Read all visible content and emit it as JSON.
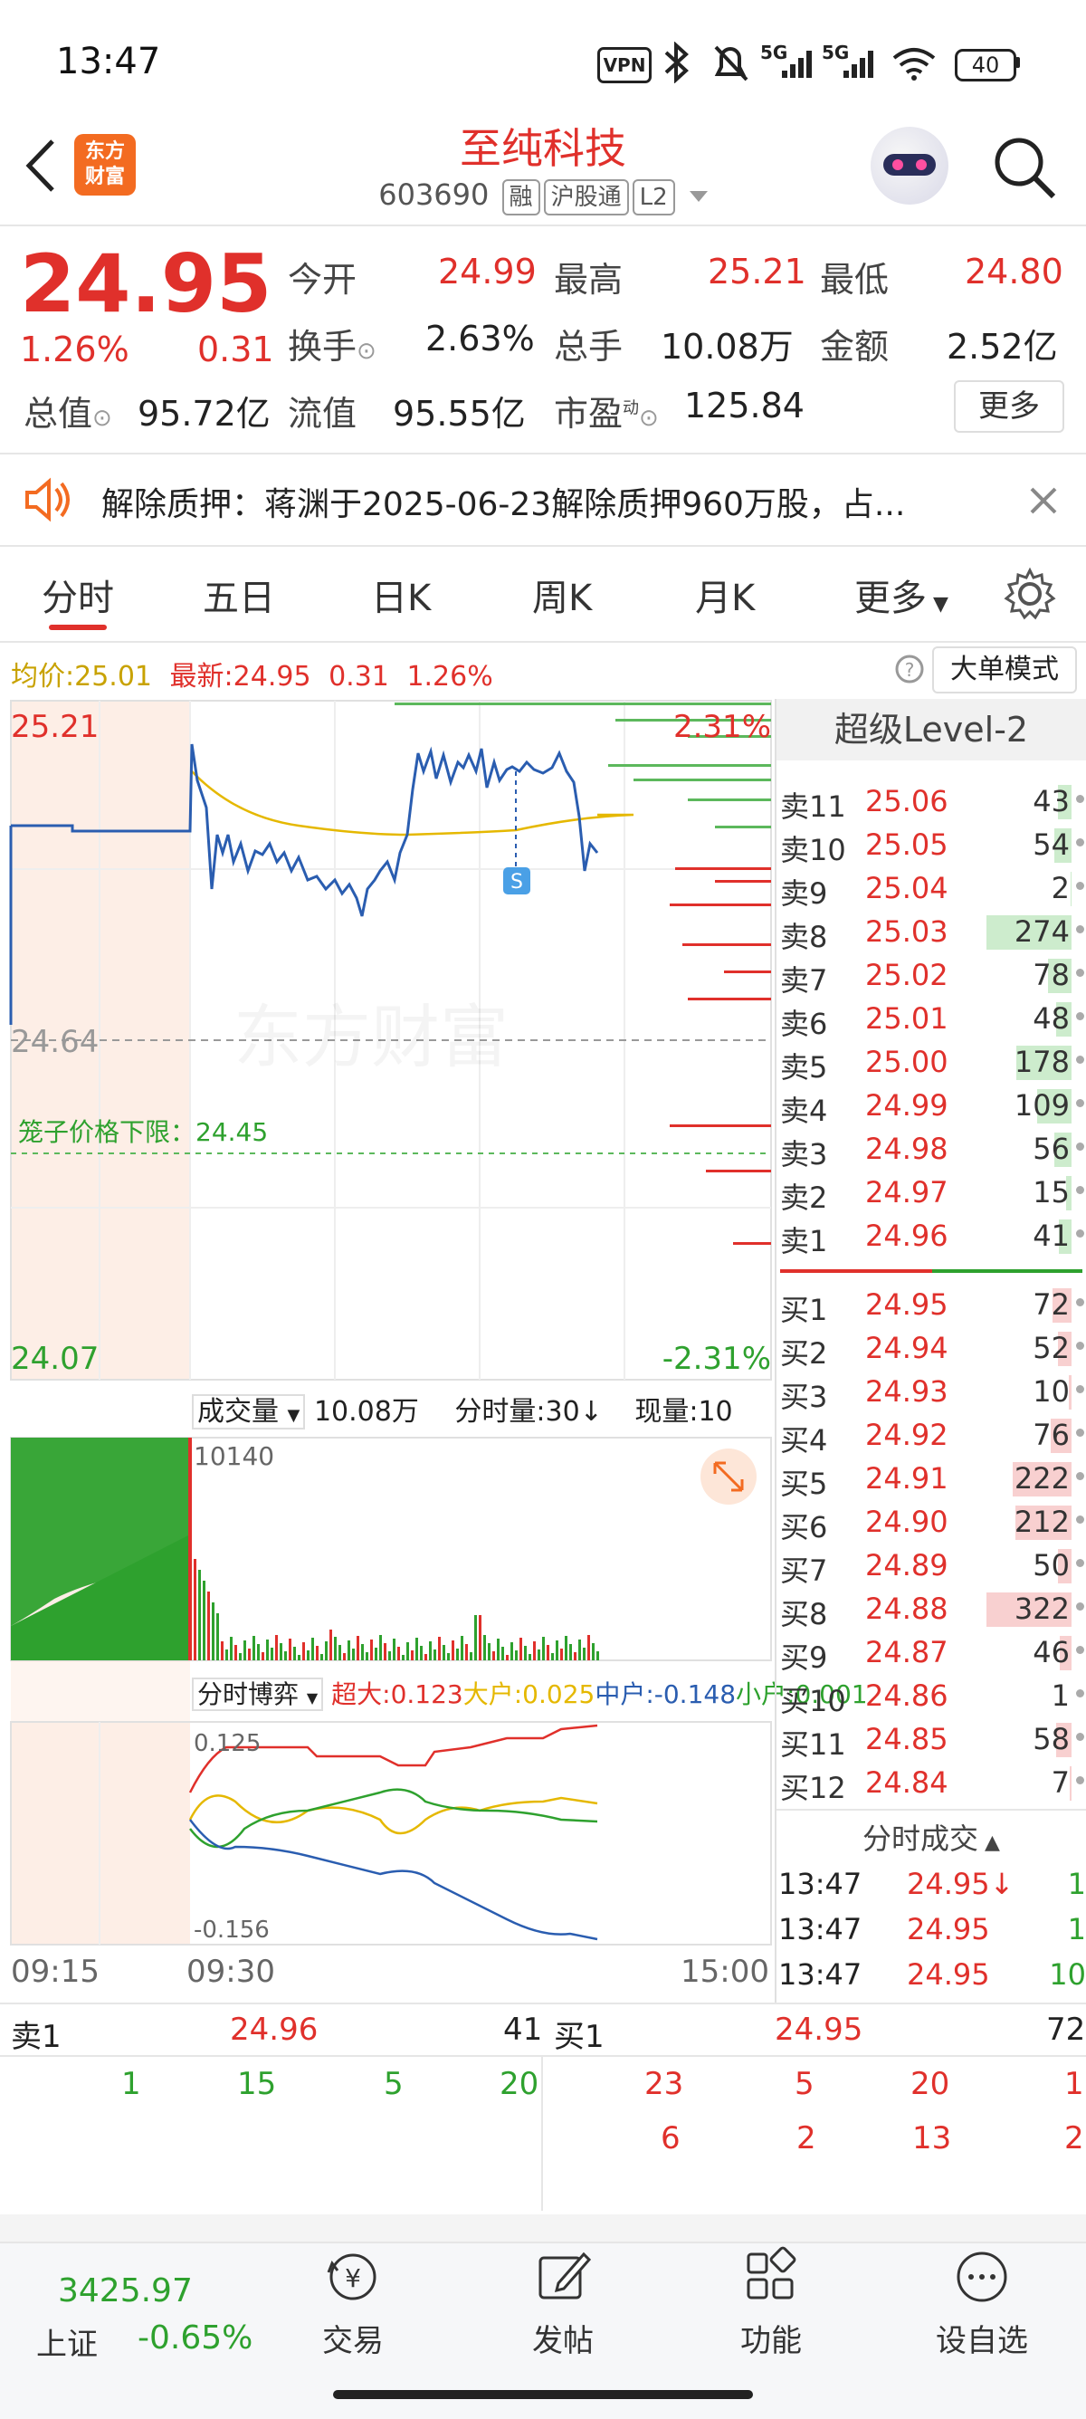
{
  "status_bar": {
    "time": "13:47",
    "battery": "40",
    "icons": [
      "vpn-icon",
      "bluetooth-icon",
      "mute-icon",
      "signal-5g-icon",
      "signal-5g-icon",
      "wifi-icon",
      "battery-icon"
    ]
  },
  "header": {
    "app_logo": "东方\n财富",
    "title": "至纯科技",
    "code": "603690",
    "tags": [
      "融",
      "沪股通",
      "L2"
    ]
  },
  "quote": {
    "price": "24.95",
    "change_pct": "1.26%",
    "change": "0.31",
    "open_label": "今开",
    "open": "24.99",
    "high_label": "最高",
    "high": "25.21",
    "low_label": "最低",
    "low": "24.80",
    "turnover_label": "换手",
    "turnover": "2.63%",
    "volume_label": "总手",
    "volume": "10.08万",
    "amount_label": "金额",
    "amount": "2.52亿",
    "mktcap_label": "总值",
    "mktcap": "95.72亿",
    "float_label": "流值",
    "float": "95.55亿",
    "pe_label": "市盈",
    "pe_sup": "动",
    "pe": "125.84",
    "more_label": "更多"
  },
  "notice": {
    "text": "解除质押：蒋渊于2025-06-23解除质押960万股，占..."
  },
  "tabs": [
    "分时",
    "五日",
    "日K",
    "周K",
    "月K",
    "更多"
  ],
  "info_bar": {
    "avg_label": "均价:",
    "avg": "25.01",
    "last_label": "最新:",
    "last": "24.95",
    "chg": "0.31",
    "pct": "1.26%",
    "mode_label": "大单模式"
  },
  "chart": {
    "y_top": "25.21",
    "y_mid": "24.64",
    "y_bottom": "24.07",
    "pct_top": "2.31%",
    "pct_bottom": "-2.31%",
    "cage_label": "笼子价格下限：24.45",
    "watermark": "东方财富",
    "marker": "S",
    "volume_label": "成交量",
    "volume_total": "10.08万",
    "volume_sub": "分时量:30↓",
    "now_label": "现量:10",
    "volume_max": "10140",
    "flow_label": "分时博弈",
    "flow_legend": [
      {
        "name": "超大:0.123",
        "color": "#e0302b"
      },
      {
        "name": "大户:0.025",
        "color": "#e5b800"
      },
      {
        "name": "中户:-0.148",
        "color": "#2a5db0"
      },
      {
        "name": "小户:0.001",
        "color": "#2ea12e"
      }
    ],
    "flow_top": "0.125",
    "flow_bottom": "-0.156",
    "x_labels": [
      "09:15",
      "09:30",
      "15:00"
    ]
  },
  "chart_data": {
    "type": "line",
    "x": [
      "09:15",
      "09:30",
      "15:00"
    ],
    "ylim": [
      24.07,
      25.21
    ],
    "series": [
      {
        "name": "",
        "values": [
          24.95,
          25.15,
          24.9,
          24.82,
          24.95,
          25.05,
          25.0,
          25.1,
          24.95
        ]
      }
    ]
  },
  "order_book": {
    "title": "超级Level-2",
    "sells": [
      {
        "label": "卖11",
        "price": "25.06",
        "vol": "43",
        "w": 0.16
      },
      {
        "label": "卖10",
        "price": "25.05",
        "vol": "54",
        "w": 0.2
      },
      {
        "label": "卖9",
        "price": "25.04",
        "vol": "2",
        "w": 0.01
      },
      {
        "label": "卖8",
        "price": "25.03",
        "vol": "274",
        "w": 1.0
      },
      {
        "label": "卖7",
        "price": "25.02",
        "vol": "78",
        "w": 0.28
      },
      {
        "label": "卖6",
        "price": "25.01",
        "vol": "48",
        "w": 0.18
      },
      {
        "label": "卖5",
        "price": "25.00",
        "vol": "178",
        "w": 0.65
      },
      {
        "label": "卖4",
        "price": "24.99",
        "vol": "109",
        "w": 0.4
      },
      {
        "label": "卖3",
        "price": "24.98",
        "vol": "56",
        "w": 0.2
      },
      {
        "label": "卖2",
        "price": "24.97",
        "vol": "15",
        "w": 0.06
      },
      {
        "label": "卖1",
        "price": "24.96",
        "vol": "41",
        "w": 0.15
      }
    ],
    "buys": [
      {
        "label": "买1",
        "price": "24.95",
        "vol": "72",
        "w": 0.22
      },
      {
        "label": "买2",
        "price": "24.94",
        "vol": "52",
        "w": 0.16
      },
      {
        "label": "买3",
        "price": "24.93",
        "vol": "10",
        "w": 0.03
      },
      {
        "label": "买4",
        "price": "24.92",
        "vol": "76",
        "w": 0.24
      },
      {
        "label": "买5",
        "price": "24.91",
        "vol": "222",
        "w": 0.69
      },
      {
        "label": "买6",
        "price": "24.90",
        "vol": "212",
        "w": 0.66
      },
      {
        "label": "买7",
        "price": "24.89",
        "vol": "50",
        "w": 0.16
      },
      {
        "label": "买8",
        "price": "24.88",
        "vol": "322",
        "w": 1.0
      },
      {
        "label": "买9",
        "price": "24.87",
        "vol": "46",
        "w": 0.14
      },
      {
        "label": "买10",
        "price": "24.86",
        "vol": "1",
        "w": 0.0
      },
      {
        "label": "买11",
        "price": "24.85",
        "vol": "58",
        "w": 0.18
      },
      {
        "label": "买12",
        "price": "24.84",
        "vol": "7",
        "w": 0.02
      }
    ],
    "trades_title": "分时成交",
    "trades": [
      {
        "time": "13:47",
        "price": "24.95↓",
        "vol": "1"
      },
      {
        "time": "13:47",
        "price": "24.95",
        "vol": "1"
      },
      {
        "time": "13:47",
        "price": "24.95",
        "vol": "10"
      }
    ]
  },
  "level1": {
    "sell_label": "卖1",
    "sell_price": "24.96",
    "sell_vol": "41",
    "buy_label": "买1",
    "buy_price": "24.95",
    "buy_vol": "72",
    "sell_queue": [
      "1",
      "15",
      "5",
      "20"
    ],
    "buy_queue_1": [
      "23",
      "5",
      "20",
      "1"
    ],
    "buy_queue_2": [
      "6",
      "2",
      "13",
      "2"
    ]
  },
  "footer": {
    "index_value": "3425.97",
    "index_name": "上证",
    "index_chg": "-0.65%",
    "items": [
      {
        "label": "交易",
        "icon": "trade-icon"
      },
      {
        "label": "发帖",
        "icon": "post-icon"
      },
      {
        "label": "功能",
        "icon": "function-icon"
      },
      {
        "label": "设自选",
        "icon": "add-watchlist-icon"
      }
    ]
  }
}
